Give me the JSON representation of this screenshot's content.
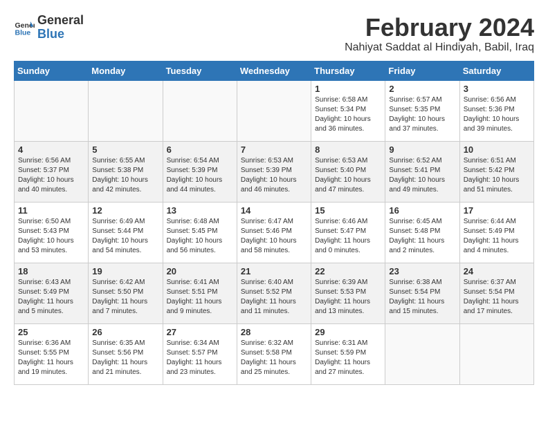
{
  "logo": {
    "line1": "General",
    "line2": "Blue"
  },
  "title": "February 2024",
  "location": "Nahiyat Saddat al Hindiyah, Babil, Iraq",
  "weekdays": [
    "Sunday",
    "Monday",
    "Tuesday",
    "Wednesday",
    "Thursday",
    "Friday",
    "Saturday"
  ],
  "weeks": [
    [
      {
        "day": "",
        "info": ""
      },
      {
        "day": "",
        "info": ""
      },
      {
        "day": "",
        "info": ""
      },
      {
        "day": "",
        "info": ""
      },
      {
        "day": "1",
        "info": "Sunrise: 6:58 AM\nSunset: 5:34 PM\nDaylight: 10 hours\nand 36 minutes."
      },
      {
        "day": "2",
        "info": "Sunrise: 6:57 AM\nSunset: 5:35 PM\nDaylight: 10 hours\nand 37 minutes."
      },
      {
        "day": "3",
        "info": "Sunrise: 6:56 AM\nSunset: 5:36 PM\nDaylight: 10 hours\nand 39 minutes."
      }
    ],
    [
      {
        "day": "4",
        "info": "Sunrise: 6:56 AM\nSunset: 5:37 PM\nDaylight: 10 hours\nand 40 minutes."
      },
      {
        "day": "5",
        "info": "Sunrise: 6:55 AM\nSunset: 5:38 PM\nDaylight: 10 hours\nand 42 minutes."
      },
      {
        "day": "6",
        "info": "Sunrise: 6:54 AM\nSunset: 5:39 PM\nDaylight: 10 hours\nand 44 minutes."
      },
      {
        "day": "7",
        "info": "Sunrise: 6:53 AM\nSunset: 5:39 PM\nDaylight: 10 hours\nand 46 minutes."
      },
      {
        "day": "8",
        "info": "Sunrise: 6:53 AM\nSunset: 5:40 PM\nDaylight: 10 hours\nand 47 minutes."
      },
      {
        "day": "9",
        "info": "Sunrise: 6:52 AM\nSunset: 5:41 PM\nDaylight: 10 hours\nand 49 minutes."
      },
      {
        "day": "10",
        "info": "Sunrise: 6:51 AM\nSunset: 5:42 PM\nDaylight: 10 hours\nand 51 minutes."
      }
    ],
    [
      {
        "day": "11",
        "info": "Sunrise: 6:50 AM\nSunset: 5:43 PM\nDaylight: 10 hours\nand 53 minutes."
      },
      {
        "day": "12",
        "info": "Sunrise: 6:49 AM\nSunset: 5:44 PM\nDaylight: 10 hours\nand 54 minutes."
      },
      {
        "day": "13",
        "info": "Sunrise: 6:48 AM\nSunset: 5:45 PM\nDaylight: 10 hours\nand 56 minutes."
      },
      {
        "day": "14",
        "info": "Sunrise: 6:47 AM\nSunset: 5:46 PM\nDaylight: 10 hours\nand 58 minutes."
      },
      {
        "day": "15",
        "info": "Sunrise: 6:46 AM\nSunset: 5:47 PM\nDaylight: 11 hours\nand 0 minutes."
      },
      {
        "day": "16",
        "info": "Sunrise: 6:45 AM\nSunset: 5:48 PM\nDaylight: 11 hours\nand 2 minutes."
      },
      {
        "day": "17",
        "info": "Sunrise: 6:44 AM\nSunset: 5:49 PM\nDaylight: 11 hours\nand 4 minutes."
      }
    ],
    [
      {
        "day": "18",
        "info": "Sunrise: 6:43 AM\nSunset: 5:49 PM\nDaylight: 11 hours\nand 5 minutes."
      },
      {
        "day": "19",
        "info": "Sunrise: 6:42 AM\nSunset: 5:50 PM\nDaylight: 11 hours\nand 7 minutes."
      },
      {
        "day": "20",
        "info": "Sunrise: 6:41 AM\nSunset: 5:51 PM\nDaylight: 11 hours\nand 9 minutes."
      },
      {
        "day": "21",
        "info": "Sunrise: 6:40 AM\nSunset: 5:52 PM\nDaylight: 11 hours\nand 11 minutes."
      },
      {
        "day": "22",
        "info": "Sunrise: 6:39 AM\nSunset: 5:53 PM\nDaylight: 11 hours\nand 13 minutes."
      },
      {
        "day": "23",
        "info": "Sunrise: 6:38 AM\nSunset: 5:54 PM\nDaylight: 11 hours\nand 15 minutes."
      },
      {
        "day": "24",
        "info": "Sunrise: 6:37 AM\nSunset: 5:54 PM\nDaylight: 11 hours\nand 17 minutes."
      }
    ],
    [
      {
        "day": "25",
        "info": "Sunrise: 6:36 AM\nSunset: 5:55 PM\nDaylight: 11 hours\nand 19 minutes."
      },
      {
        "day": "26",
        "info": "Sunrise: 6:35 AM\nSunset: 5:56 PM\nDaylight: 11 hours\nand 21 minutes."
      },
      {
        "day": "27",
        "info": "Sunrise: 6:34 AM\nSunset: 5:57 PM\nDaylight: 11 hours\nand 23 minutes."
      },
      {
        "day": "28",
        "info": "Sunrise: 6:32 AM\nSunset: 5:58 PM\nDaylight: 11 hours\nand 25 minutes."
      },
      {
        "day": "29",
        "info": "Sunrise: 6:31 AM\nSunset: 5:59 PM\nDaylight: 11 hours\nand 27 minutes."
      },
      {
        "day": "",
        "info": ""
      },
      {
        "day": "",
        "info": ""
      }
    ]
  ]
}
